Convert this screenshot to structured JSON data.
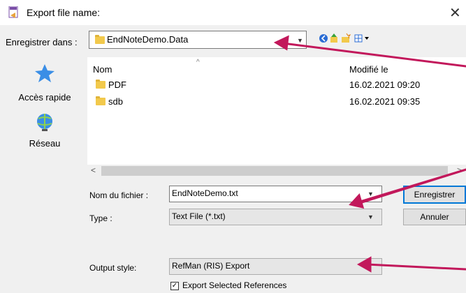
{
  "window": {
    "title": "Export file name:",
    "close_glyph": "✕"
  },
  "lookin": {
    "label": "Enregistrer dans :",
    "value": "EndNoteDemo.Data"
  },
  "places": [
    {
      "label": "Accès rapide",
      "icon": "star-icon"
    },
    {
      "label": "Réseau",
      "icon": "network-icon"
    }
  ],
  "filelist": {
    "col_name": "Nom",
    "col_modified": "Modifié le",
    "rows": [
      {
        "name": "PDF",
        "modified": "16.02.2021 09:20"
      },
      {
        "name": "sdb",
        "modified": "16.02.2021 09:35"
      }
    ]
  },
  "filename": {
    "label": "Nom du fichier :",
    "value": "EndNoteDemo.txt"
  },
  "type": {
    "label": "Type :",
    "value": "Text File (*.txt)"
  },
  "buttons": {
    "save": "Enregistrer",
    "cancel": "Annuler"
  },
  "output_style": {
    "label": "Output style:",
    "value": "RefMan (RIS) Export"
  },
  "export_selected": {
    "label": "Export Selected References",
    "checked": true,
    "mark": "✓"
  },
  "annotation_color": "#c2185b"
}
